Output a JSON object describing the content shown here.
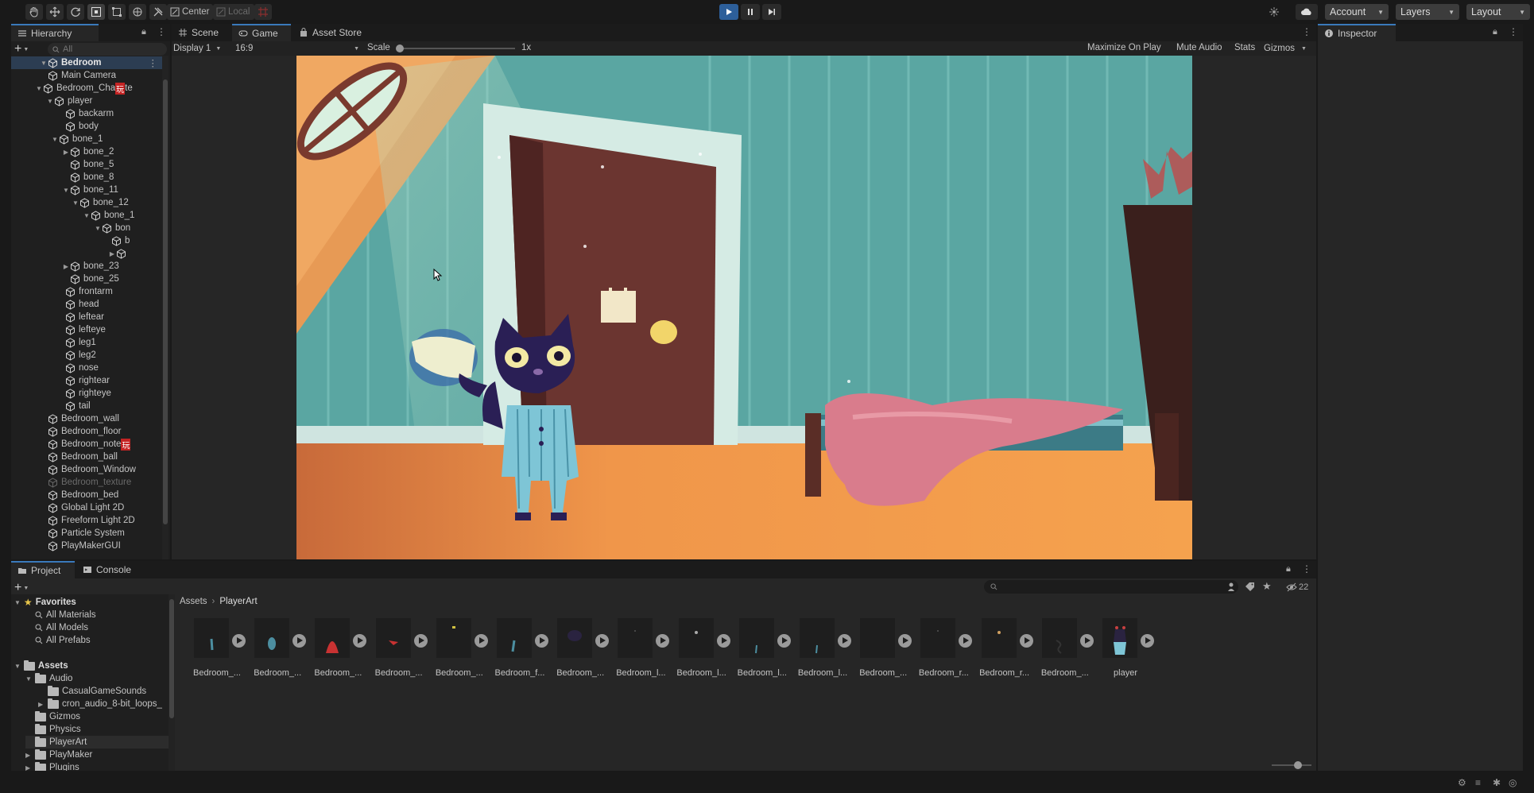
{
  "toolbar": {
    "pivot_label": "Center",
    "space_label": "Local",
    "account_label": "Account",
    "layers_label": "Layers",
    "layout_label": "Layout"
  },
  "hierarchy": {
    "tab_label": "Hierarchy",
    "search_placeholder": "All",
    "scene_name": "Bedroom",
    "items": [
      {
        "label": "Main Camera"
      },
      {
        "label": "Bedroom_Cha",
        "suffix": "te",
        "badge": "玩"
      },
      {
        "label": "player"
      },
      {
        "label": "backarm"
      },
      {
        "label": "body"
      },
      {
        "label": "bone_1"
      },
      {
        "label": "bone_2"
      },
      {
        "label": "bone_5"
      },
      {
        "label": "bone_8"
      },
      {
        "label": "bone_11"
      },
      {
        "label": "bone_12"
      },
      {
        "label": "bone_1"
      },
      {
        "label": "bon"
      },
      {
        "label": "b"
      },
      {
        "label": ""
      },
      {
        "label": "bone_23"
      },
      {
        "label": "bone_25"
      },
      {
        "label": "frontarm"
      },
      {
        "label": "head"
      },
      {
        "label": "leftear"
      },
      {
        "label": "lefteye"
      },
      {
        "label": "leg1"
      },
      {
        "label": "leg2"
      },
      {
        "label": "nose"
      },
      {
        "label": "rightear"
      },
      {
        "label": "righteye"
      },
      {
        "label": "tail"
      },
      {
        "label": "Bedroom_wall"
      },
      {
        "label": "Bedroom_floor"
      },
      {
        "label": "Bedroom_note",
        "badge": "玩"
      },
      {
        "label": "Bedroom_ball"
      },
      {
        "label": "Bedroom_Window"
      },
      {
        "label": "Bedroom_texture"
      },
      {
        "label": "Bedroom_bed"
      },
      {
        "label": "Global Light 2D"
      },
      {
        "label": "Freeform Light 2D"
      },
      {
        "label": "Particle System"
      },
      {
        "label": "PlayMakerGUI"
      }
    ]
  },
  "center": {
    "tabs": [
      "Scene",
      "Game",
      "Asset Store"
    ],
    "display_label": "Display 1",
    "aspect_label": "16:9",
    "scale_label": "Scale",
    "scale_value": "1x",
    "scale_fraction": 0.0,
    "maximize_label": "Maximize On Play",
    "mute_label": "Mute Audio",
    "stats_label": "Stats",
    "gizmos_label": "Gizmos"
  },
  "inspector": {
    "tab_label": "Inspector"
  },
  "project": {
    "tabs": [
      "Project",
      "Console"
    ],
    "breadcrumb": [
      "Assets",
      "PlayerArt"
    ],
    "visibility_count": "22",
    "tree": {
      "favorites_label": "Favorites",
      "favorites": [
        "All Materials",
        "All Models",
        "All Prefabs"
      ],
      "assets_label": "Assets",
      "folders": [
        {
          "label": "Audio"
        },
        {
          "label": "CasualGameSounds"
        },
        {
          "label": "cron_audio_8-bit_loops_"
        },
        {
          "label": "Gizmos"
        },
        {
          "label": "Physics"
        },
        {
          "label": "PlayerArt"
        },
        {
          "label": "PlayMaker"
        },
        {
          "label": "Plugins"
        }
      ]
    },
    "assets": [
      {
        "label": "Bedroom_..."
      },
      {
        "label": "Bedroom_..."
      },
      {
        "label": "Bedroom_..."
      },
      {
        "label": "Bedroom_..."
      },
      {
        "label": "Bedroom_..."
      },
      {
        "label": "Bedroom_f..."
      },
      {
        "label": "Bedroom_..."
      },
      {
        "label": "Bedroom_l..."
      },
      {
        "label": "Bedroom_l..."
      },
      {
        "label": "Bedroom_l..."
      },
      {
        "label": "Bedroom_l..."
      },
      {
        "label": "Bedroom_..."
      },
      {
        "label": "Bedroom_r..."
      },
      {
        "label": "Bedroom_r..."
      },
      {
        "label": "Bedroom_..."
      },
      {
        "label": "player"
      }
    ]
  },
  "colors": {
    "accent": "#3a79bb",
    "play_button": "#2d5f9a",
    "wall": "#5fa8a4",
    "floor": "#f19b4a",
    "door": "#6b3530",
    "blanket": "#d97c8c",
    "pajama": "#7ec5d6",
    "cat": "#2a1f55"
  }
}
